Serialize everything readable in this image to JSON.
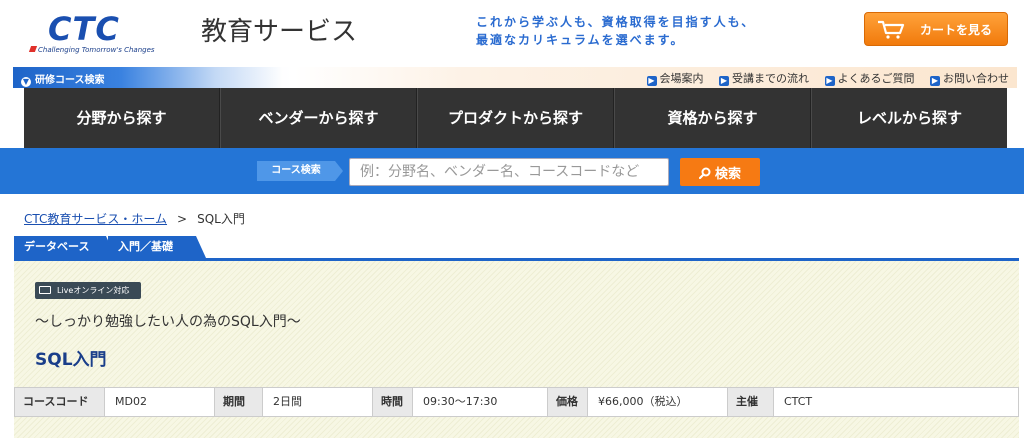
{
  "header": {
    "logo_text": "CTC",
    "logo_tagline": "Challenging Tomorrow's Changes",
    "site_title": "教育サービス",
    "catch_line1": "これから学ぶ人も、資格取得を目指す人も、",
    "catch_line2": "最適なカリキュラムを選べます。",
    "cart_label": "カートを見る"
  },
  "subbar": {
    "left_label": "研修コース検索",
    "links": [
      "会場案内",
      "受講までの流れ",
      "よくあるご質問",
      "お問い合わせ"
    ]
  },
  "mainnav": [
    "分野から探す",
    "ベンダーから探す",
    "プロダクトから探す",
    "資格から探す",
    "レベルから探す"
  ],
  "search": {
    "tag": "コース検索",
    "placeholder": "例：分野名、ベンダー名、コースコードなど",
    "button": "検索"
  },
  "breadcrumb": {
    "home": "CTC教育サービス・ホーム",
    "separator": ">",
    "current": "SQL入門"
  },
  "tabs": [
    "データベース",
    "入門／基礎"
  ],
  "course": {
    "badge": "Liveオンライン対応",
    "subtitle": "～しっかり勉強したい人の為のSQL入門～",
    "title": "SQL入門",
    "info": {
      "code_label": "コースコード",
      "code": "MD02",
      "period_label": "期間",
      "period": "2日間",
      "time_label": "時間",
      "time": "09:30～17:30",
      "price_label": "価格",
      "price": "¥66,000（税込）",
      "host_label": "主催",
      "host": "CTCT"
    }
  },
  "colors": {
    "brand_blue": "#1e64c8",
    "search_blue": "#2475d6",
    "nav_dark": "#333333",
    "accent_orange": "#f67a13"
  }
}
